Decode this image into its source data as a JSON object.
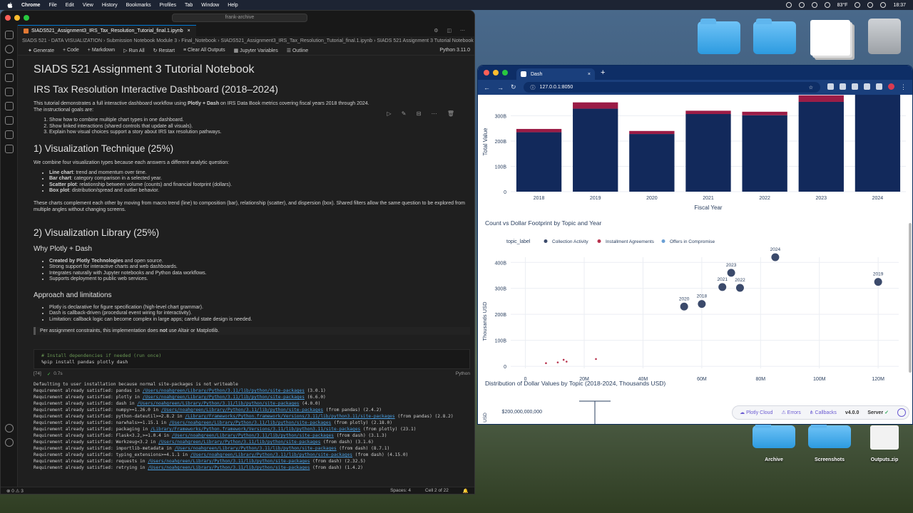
{
  "menubar": {
    "app": "Chrome",
    "items": [
      "File",
      "Edit",
      "View",
      "History",
      "Bookmarks",
      "Profiles",
      "Tab",
      "Window",
      "Help"
    ],
    "weather": "83°F",
    "clock": "18:37"
  },
  "desktop": {
    "items": [
      {
        "label": "Archive"
      },
      {
        "label": "Screenshots"
      },
      {
        "label": "Outputs.zip"
      }
    ]
  },
  "vscode": {
    "search_placeholder": "frank-archive",
    "tab": "SIADS521_Assignment3_IRS_Tax_Resolution_Tutorial_final.1.ipynb",
    "breadcrumb": "SIADS 521 - DATA VISUALIZATION › Submission Notebook Module 3 › Final_Notebook › SIADS521_Assignment3_IRS_Tax_Resolution_Tutorial_final.1.ipynb › SIADS 521 Assignment 3 Tutorial Notebook",
    "toolbar": [
      "Generate",
      "Code",
      "Markdown",
      "Run All",
      "Restart",
      "Clear All Outputs",
      "Jupyter Variables",
      "Outline"
    ],
    "kernel": "Python 3.11.0",
    "h1": "SIADS 521 Assignment 3 Tutorial Notebook",
    "h1b": "IRS Tax Resolution Interactive Dashboard (2018–2024)",
    "intro_pre": "This tutorial demonstrates a full interactive dashboard workflow using ",
    "intro_bold": "Plotly + Dash",
    "intro_post": " on IRS Data Book metrics covering fiscal years 2018 through 2024.",
    "intro_goals": "The instructional goals are:",
    "goals": [
      "Show how to combine multiple chart types in one dashboard.",
      "Show linked interactions (shared controls that update all visuals).",
      "Explain how visual choices support a story about IRS tax resolution pathways."
    ],
    "sec1": "1) Visualization Technique (25%)",
    "sec1_intro": "We combine four visualization types because each answers a different analytic question:",
    "sec1_items": [
      {
        "b": "Line chart",
        "t": ": trend and momentum over time."
      },
      {
        "b": "Bar chart",
        "t": ": category comparison in a selected year."
      },
      {
        "b": "Scatter plot",
        "t": ": relationship between volume (counts) and financial footprint (dollars)."
      },
      {
        "b": "Box plot",
        "t": ": distribution/spread and outlier behavior."
      }
    ],
    "sec1_para": "These charts complement each other by moving from macro trend (line) to composition (bar), relationship (scatter), and dispersion (box). Shared filters allow the same question to be explored from multiple angles without changing screens.",
    "sec2": "2) Visualization Library (25%)",
    "why": "Why Plotly + Dash",
    "why_items": [
      {
        "b": "Created by Plotly Technologies",
        "t": " and open source."
      },
      {
        "b": "",
        "t": "Strong support for interactive charts and web dashboards."
      },
      {
        "b": "",
        "t": "Integrates naturally with Jupyter notebooks and Python data workflows."
      },
      {
        "b": "",
        "t": "Supports deployment to public web services."
      }
    ],
    "approach": "Approach and limitations",
    "approach_items": [
      "Plotly is declarative for figure specification (high-level chart grammar).",
      "Dash is callback-driven (procedural event wiring for interactivity).",
      "Limitation: callback logic can become complex in large apps; careful state design is needed."
    ],
    "quote_pre": "Per assignment constraints, this implementation does ",
    "quote_bold": "not",
    "quote_post": " use Altair or Matplotlib.",
    "code_comment": "# Install dependencies if needed (run once)",
    "code_line": "%pip install pandas plotly dash",
    "exec_count": "[74]",
    "exec_time": "0.7s",
    "cell_lang": "Python",
    "output_lines": [
      {
        "pre": "Defaulting to user installation because normal site-packages is not writeable",
        "link": "",
        "post": ""
      },
      {
        "pre": "Requirement already satisfied: pandas in ",
        "link": "/Users/noahgreen/Library/Python/3.11/lib/python/site-packages",
        "post": " (3.0.1)"
      },
      {
        "pre": "Requirement already satisfied: plotly in ",
        "link": "/Users/noahgreen/Library/Python/3.11/lib/python/site-packages",
        "post": " (6.6.0)"
      },
      {
        "pre": "Requirement already satisfied: dash in ",
        "link": "/Users/noahgreen/Library/Python/3.11/lib/python/site-packages",
        "post": " (4.0.0)"
      },
      {
        "pre": "Requirement already satisfied: numpy>=1.26.0 in ",
        "link": "/Users/noahgreen/Library/Python/3.11/lib/python/site-packages",
        "post": " (from pandas) (2.4.2)"
      },
      {
        "pre": "Requirement already satisfied: python-dateutil>=2.8.2 in ",
        "link": "/Library/Frameworks/Python.framework/Versions/3.11/lib/python3.11/site-packages",
        "post": " (from pandas) (2.8.2)"
      },
      {
        "pre": "Requirement already satisfied: narwhals>=1.15.1 in ",
        "link": "/Users/noahgreen/Library/Python/3.11/lib/python/site-packages",
        "post": " (from plotly) (2.18.0)"
      },
      {
        "pre": "Requirement already satisfied: packaging in ",
        "link": "/Library/Frameworks/Python.framework/Versions/3.11/lib/python3.11/site-packages",
        "post": " (from plotly) (23.1)"
      },
      {
        "pre": "Requirement already satisfied: Flask<3.2,>=1.0.4 in ",
        "link": "/Users/noahgreen/Library/Python/3.11/lib/python/site-packages",
        "post": " (from dash) (3.1.3)"
      },
      {
        "pre": "Requirement already satisfied: Werkzeug<3.2 in ",
        "link": "/Users/noahgreen/Library/Python/3.11/lib/python/site-packages",
        "post": " (from dash) (3.1.6)"
      },
      {
        "pre": "Requirement already satisfied: importlib-metadata in ",
        "link": "/Users/noahgreen/Library/Python/3.11/lib/python/site-packages",
        "post": " (from dash) (8.7.1)"
      },
      {
        "pre": "Requirement already satisfied: typing_extensions>=4.1.1 in ",
        "link": "/Users/noahgreen/Library/Python/3.11/lib/python/site-packages",
        "post": " (from dash) (4.15.0)"
      },
      {
        "pre": "Requirement already satisfied: requests in ",
        "link": "/Users/noahgreen/Library/Python/3.11/lib/python/site-packages",
        "post": " (from dash) (2.32.5)"
      },
      {
        "pre": "Requirement already satisfied: retrying in ",
        "link": "/Users/noahgreen/Library/Python/3.11/lib/python/site-packages",
        "post": " (from dash) (1.4.2)"
      }
    ],
    "status_left": "⊗ 0 ⚠ 3",
    "status_spaces": "Spaces: 4",
    "status_cell": "Cell 2 of 22"
  },
  "chrome": {
    "tab_title": "Dash",
    "url": "127.0.0.1:8050"
  },
  "chart_data": [
    {
      "type": "bar",
      "title": "",
      "xlabel": "Fiscal Year",
      "ylabel": "Total Value",
      "categories": [
        "2018",
        "2019",
        "2020",
        "2021",
        "2022",
        "2023",
        "2024"
      ],
      "yticks": [
        "0",
        "100B",
        "200B",
        "300B"
      ],
      "ylim": [
        0,
        380
      ],
      "series": [
        {
          "values": [
            235,
            328,
            228,
            307,
            302,
            355,
            385
          ],
          "color": "#12295b"
        },
        {
          "values": [
            13,
            25,
            12,
            13,
            14,
            26,
            0
          ],
          "color": "#9b1c46"
        }
      ]
    },
    {
      "type": "scatter",
      "title": "Count vs Dollar Footprint by Topic and Year",
      "xlabel": "Count",
      "ylabel": "Thousands USD",
      "xticks": [
        "0",
        "20M",
        "40M",
        "60M",
        "80M",
        "100M",
        "120M"
      ],
      "yticks": [
        "0",
        "100B",
        "200B",
        "300B",
        "400B"
      ],
      "xlim": [
        -5,
        127
      ],
      "ylim": [
        -8,
        420
      ],
      "legend_title": "topic_label",
      "legend": [
        {
          "name": "Collection Activity",
          "color": "#3b4a6b"
        },
        {
          "name": "Installment Agreements",
          "color": "#b8324d"
        },
        {
          "name": "Offers in Compromise",
          "color": "#6a9fd4"
        }
      ],
      "points": [
        {
          "x": 54,
          "y": 230,
          "label": "2020",
          "series": 0
        },
        {
          "x": 60,
          "y": 240,
          "label": "2018",
          "series": 0
        },
        {
          "x": 67,
          "y": 305,
          "label": "2021",
          "series": 0
        },
        {
          "x": 70,
          "y": 360,
          "label": "2023",
          "series": 0
        },
        {
          "x": 73,
          "y": 302,
          "label": "2022",
          "series": 0
        },
        {
          "x": 85,
          "y": 420,
          "label": "2024",
          "series": 0
        },
        {
          "x": 120,
          "y": 325,
          "label": "2019",
          "series": 0
        },
        {
          "x": 7,
          "y": 12,
          "label": "",
          "series": 1
        },
        {
          "x": 11,
          "y": 15,
          "label": "",
          "series": 1
        },
        {
          "x": 13,
          "y": 25,
          "label": "",
          "series": 1
        },
        {
          "x": 14,
          "y": 18,
          "label": "",
          "series": 1
        },
        {
          "x": 24,
          "y": 28,
          "label": "",
          "series": 1
        }
      ]
    },
    {
      "type": "box",
      "title": "Distribution of Dollar Values by Topic (2018-2024, Thousands USD)",
      "ytick": "$200,000,000,000",
      "ylabel": "USD"
    }
  ],
  "dash_footer": {
    "items": [
      "Plotly Cloud",
      "Errors",
      "Callbacks"
    ],
    "version": "v4.0.0",
    "server": "Server"
  }
}
